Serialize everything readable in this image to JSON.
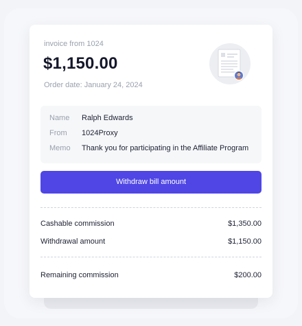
{
  "invoice": {
    "from_label": "invoice from 1024",
    "amount": "$1,150.00",
    "order_date": "Order date: January 24, 2024"
  },
  "details": [
    {
      "label": "Name",
      "value": "Ralph Edwards"
    },
    {
      "label": "From",
      "value": "1024Proxy"
    },
    {
      "label": "Memo",
      "value": "Thank you for participating in the Affiliate Program"
    }
  ],
  "withdraw_button_label": "Withdraw bill amount",
  "summary": {
    "cashable_label": "Cashable commission",
    "cashable_value": "$1,350.00",
    "withdrawal_label": "Withdrawal amount",
    "withdrawal_value": "$1,150.00",
    "remaining_label": "Remaining commission",
    "remaining_value": "$200.00"
  },
  "colors": {
    "accent": "#4f46e5",
    "title": "#15172b",
    "muted": "#9aa0ad"
  },
  "icons": {
    "document": "document-illustration",
    "avatar": "user-avatar-icon"
  }
}
